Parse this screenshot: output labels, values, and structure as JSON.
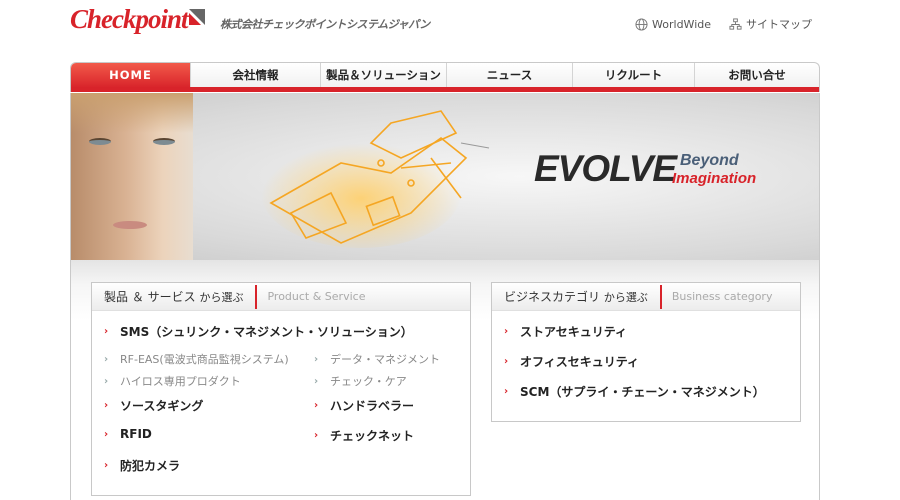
{
  "header": {
    "logo_text": "Checkpoint",
    "company_jp": "株式会社チェックポイントシステムジャパン",
    "links": [
      {
        "label": "WorldWide",
        "icon": "globe-icon"
      },
      {
        "label": "サイトマップ",
        "icon": "sitemap-icon"
      }
    ]
  },
  "nav": {
    "items": [
      {
        "label": "HOME",
        "active": true
      },
      {
        "label": "会社情報",
        "active": false
      },
      {
        "label": "製品＆ソリューション",
        "active": false
      },
      {
        "label": "ニュース",
        "active": false
      },
      {
        "label": "リクルート",
        "active": false
      },
      {
        "label": "お問い合せ",
        "active": false
      }
    ]
  },
  "hero": {
    "headline": "EVOLVE",
    "tagline_1": "Beyond",
    "tagline_2": "Imagination"
  },
  "products": {
    "title_jp": "製品 ＆ サービス",
    "title_jp_suffix": "から選ぶ",
    "title_en": "Product & Service",
    "items": [
      "SMS（シュリンク・マネジメント・ソリューション）",
      "RF-EAS(電波式商品監視システム)",
      "データ・マネジメント",
      "ハイロス専用プロダクト",
      "チェック・ケア",
      "ソースタギング",
      "ハンドラベラー",
      "RFID",
      "チェックネット",
      "防犯カメラ"
    ]
  },
  "business": {
    "title_jp": "ビジネスカテゴリ",
    "title_jp_suffix": "から選ぶ",
    "title_en": "Business category",
    "items": [
      "ストアセキュリティ",
      "オフィスセキュリティ",
      "SCM（サプライ・チェーン・マネジメント）"
    ]
  },
  "colors": {
    "brand_red": "#d8232a",
    "accent_blue": "#4a5f78"
  }
}
